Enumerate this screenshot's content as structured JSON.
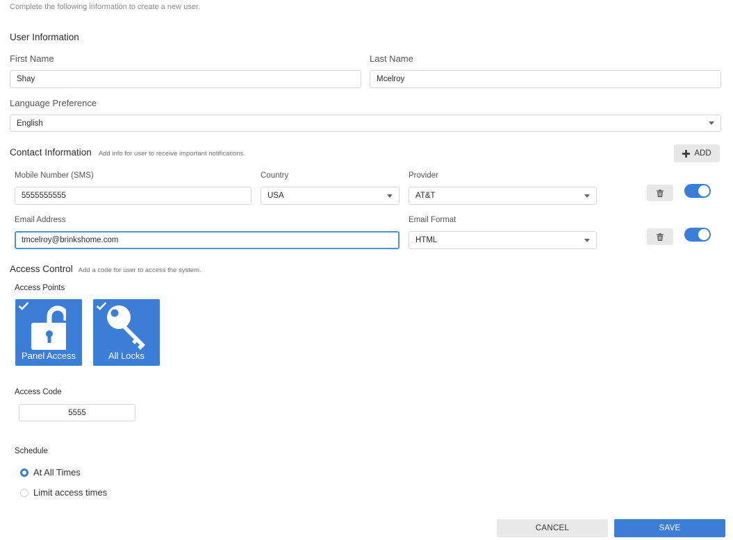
{
  "subtitle": "Complete the following information to create a new user.",
  "user_info": {
    "heading": "User Information",
    "first_name": {
      "label": "First Name",
      "value": "Shay"
    },
    "last_name": {
      "label": "Last Name",
      "value": "Mcelroy"
    },
    "language": {
      "label": "Language Preference",
      "value": "English"
    }
  },
  "contact": {
    "heading": "Contact Information",
    "note": "Add info for user to receive important notifications.",
    "add_label": "ADD",
    "mobile": {
      "label": "Mobile Number (SMS)",
      "value": "5555555555"
    },
    "country": {
      "label": "Country",
      "value": "USA"
    },
    "provider": {
      "label": "Provider",
      "value": "AT&T"
    },
    "email": {
      "label": "Email Address",
      "value": "tmcelroy@brinkshome.com"
    },
    "email_format": {
      "label": "Email Format",
      "value": "HTML"
    },
    "sms_enabled": true,
    "email_enabled": true
  },
  "access": {
    "heading": "Access Control",
    "note": "Add a code for user to access the system.",
    "points_label": "Access Points",
    "tiles": [
      {
        "label": "Panel Access",
        "icon": "unlock-icon",
        "checked": true
      },
      {
        "label": "All Locks",
        "icon": "key-icon",
        "checked": true
      }
    ],
    "code_label": "Access Code",
    "code_value": "5555",
    "schedule_label": "Schedule",
    "schedule_options": [
      {
        "label": "At All Times",
        "selected": true
      },
      {
        "label": "Limit access times",
        "selected": false
      }
    ]
  },
  "actions": {
    "cancel": "CANCEL",
    "save": "SAVE"
  },
  "colors": {
    "accent": "#3b7ed8",
    "focus": "#4a8fe0",
    "button_grey": "#e7e7e7"
  }
}
